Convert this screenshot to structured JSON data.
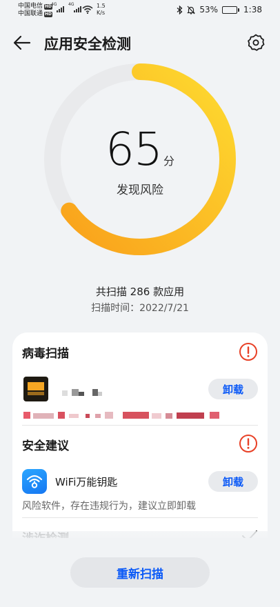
{
  "status_bar": {
    "carrier1": "中国电信",
    "carrier2": "中国联通",
    "hd_badge": "HD",
    "net1": "4G",
    "net2": "4G",
    "speed_value": "1.5",
    "speed_unit": "K/s",
    "battery_percent": "53%",
    "battery_level": 0.53,
    "time": "1:38"
  },
  "header": {
    "title": "应用安全检测"
  },
  "gauge": {
    "score": "65",
    "unit": "分",
    "label": "发现风险",
    "score_fraction": 0.65,
    "colors": {
      "track": "#e9eaec",
      "start": "#f9a11b",
      "end": "#fedb30"
    }
  },
  "summary": {
    "scanned": "共扫描 286 款应用",
    "scan_time": "扫描时间：2022/7/21"
  },
  "sections": {
    "virus": {
      "title": "病毒扫描",
      "uninstall_label": "卸载"
    },
    "advice": {
      "title": "安全建议",
      "app_name": "WiFi万能钥匙",
      "app_desc": "风险软件，存在违规行为，建议立即卸载",
      "uninstall_label": "卸载"
    },
    "fraud": {
      "title": "涉诈检测"
    }
  },
  "actions": {
    "rescan_label": "重新扫描"
  },
  "colors": {
    "accent": "#0a59f7",
    "warning": "#e84026"
  }
}
